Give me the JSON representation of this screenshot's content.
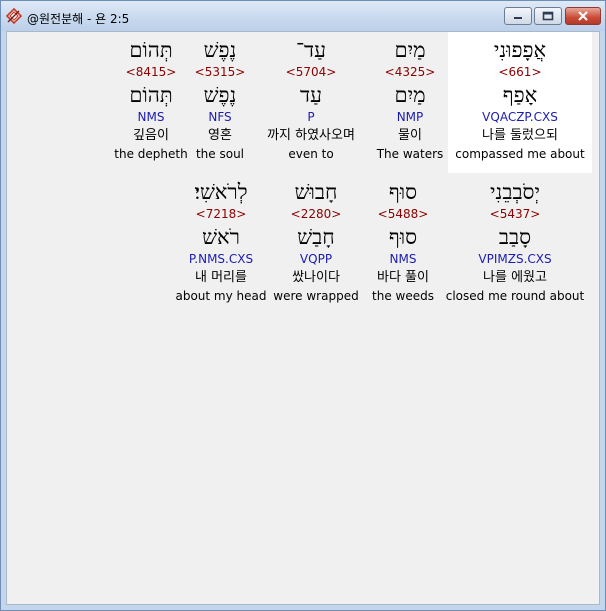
{
  "window": {
    "title": "@원전분해 - 욘 2:5"
  },
  "row1": [
    {
      "surface": "אֲפָפוּנִי",
      "strong": "<661>",
      "lemma": "אָפַף",
      "parse": "VQACZP.CXS",
      "korean": "나를 둘렀으되",
      "english": "compassed me about",
      "selected": true
    },
    {
      "surface": "מַיִם",
      "strong": "<4325>",
      "lemma": "מַיִם",
      "parse": "NMP",
      "korean": "물이",
      "english": "The waters"
    },
    {
      "surface": "עַד־",
      "strong": "<5704>",
      "lemma": "עַד",
      "parse": "P",
      "korean": "까지 하였사오며",
      "english": "even to"
    },
    {
      "surface": "נֶפֶשׁ",
      "strong": "<5315>",
      "lemma": "נֶפֶשׁ",
      "parse": "NFS",
      "korean": "영혼",
      "english": "the soul"
    },
    {
      "surface": "תְּהוֹם",
      "strong": "<8415>",
      "lemma": "תְּהוֹם",
      "parse": "NMS",
      "korean": "깊음이",
      "english": "the depheth"
    }
  ],
  "row2": [
    {
      "surface": "יְסֹבְבֵנִי",
      "strong": "<5437>",
      "lemma": "סָבַב",
      "parse": "VPIMZS.CXS",
      "korean": "나를 에웠고",
      "english": "closed me round about"
    },
    {
      "surface": "סוּף",
      "strong": "<5488>",
      "lemma": "סוּף",
      "parse": "NMS",
      "korean": "바다 풀이",
      "english": "the weeds"
    },
    {
      "surface": "חָבוּשׁ",
      "strong": "<2280>",
      "lemma": "חָבַשׁ",
      "parse": "VQPP",
      "korean": "쌌나이다",
      "english": "were wrapped"
    },
    {
      "surface": "לְרֹאשִׁי׃",
      "strong": "<7218>",
      "lemma": "רֹאשׁ",
      "parse": "P.NMS.CXS",
      "korean": "내 머리를",
      "english": "about my head"
    }
  ]
}
